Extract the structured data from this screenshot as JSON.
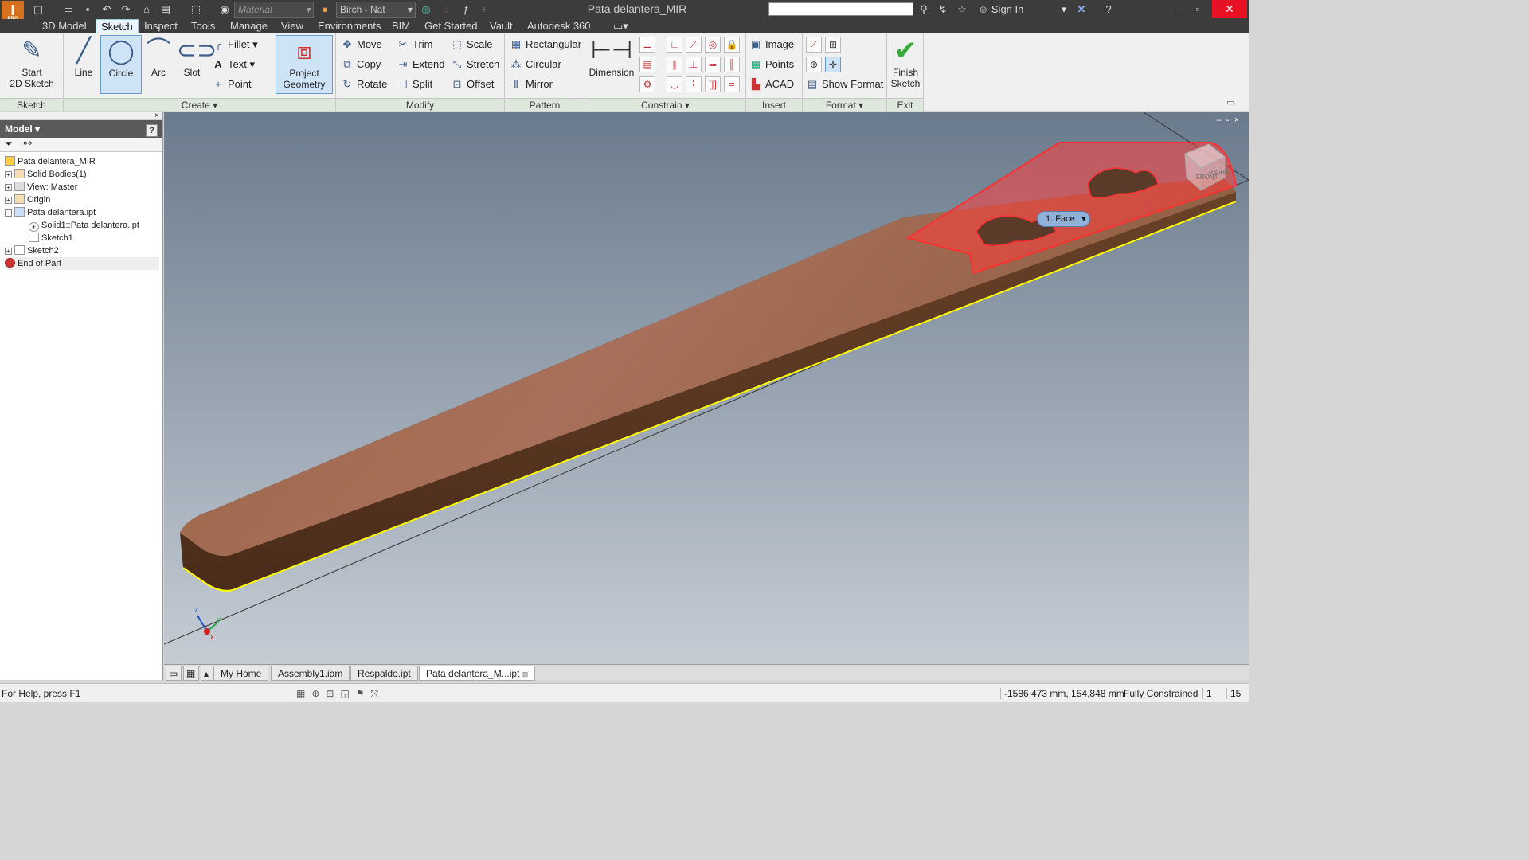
{
  "app": {
    "logo": "I",
    "edition": "PRO",
    "title": "Pata delantera_MIR"
  },
  "qat": {
    "material_placeholder": "Material",
    "appearance": "Birch - Nat"
  },
  "topright": {
    "sign_in": "Sign In"
  },
  "tabs": [
    "3D Model",
    "Sketch",
    "Inspect",
    "Tools",
    "Manage",
    "View",
    "Environments",
    "BIM",
    "Get Started",
    "Vault",
    "Autodesk 360"
  ],
  "ribbon": {
    "sketch_panel": {
      "title": "Sketch",
      "start_line1": "Start",
      "start_line2": "2D Sketch"
    },
    "create_panel": {
      "title": "Create",
      "line": "Line",
      "circle": "Circle",
      "arc": "Arc",
      "slot": "Slot",
      "fillet": "Fillet",
      "text": "Text",
      "point": "Point",
      "project_line1": "Project",
      "project_line2": "Geometry"
    },
    "modify_panel": {
      "title": "Modify",
      "move": "Move",
      "copy": "Copy",
      "rotate": "Rotate",
      "trim": "Trim",
      "extend": "Extend",
      "split": "Split",
      "scale": "Scale",
      "stretch": "Stretch",
      "offset": "Offset"
    },
    "pattern_panel": {
      "title": "Pattern",
      "rectangular": "Rectangular",
      "circular": "Circular",
      "mirror": "Mirror"
    },
    "constrain_panel": {
      "title": "Constrain",
      "dimension": "Dimension"
    },
    "insert_panel": {
      "title": "Insert",
      "image": "Image",
      "points": "Points",
      "acad": "ACAD"
    },
    "format_panel": {
      "title": "Format",
      "show_format": "Show Format"
    },
    "exit_panel": {
      "title": "Exit",
      "finish_line1": "Finish",
      "finish_line2": "Sketch"
    }
  },
  "browser": {
    "title": "Model",
    "tree": [
      "Pata delantera_MIR",
      "Solid Bodies(1)",
      "View: Master",
      "Origin",
      "Pata delantera.ipt",
      "Solid1::Pata delantera.ipt",
      "Sketch1",
      "Sketch2",
      "End of Part"
    ]
  },
  "viewport": {
    "selection_label": "1. Face",
    "triad_x": "x",
    "triad_y": "y",
    "triad_z": "z",
    "viewcube_right": "RIGHT",
    "viewcube_front": "FRONT"
  },
  "doc_tabs": [
    "My Home",
    "Assembly1.iam",
    "Respaldo.ipt",
    "Pata delantera_M...ipt"
  ],
  "status": {
    "help": "For Help, press F1",
    "coords": "-1586,473 mm, 154,848 mm",
    "constraint": "Fully Constrained",
    "num1": "1",
    "num2": "15"
  },
  "colors": {
    "accent": "#d6701c",
    "selection": "#ff3030",
    "wood": "#8b5a3c",
    "edge_highlight": "#ffff00"
  }
}
